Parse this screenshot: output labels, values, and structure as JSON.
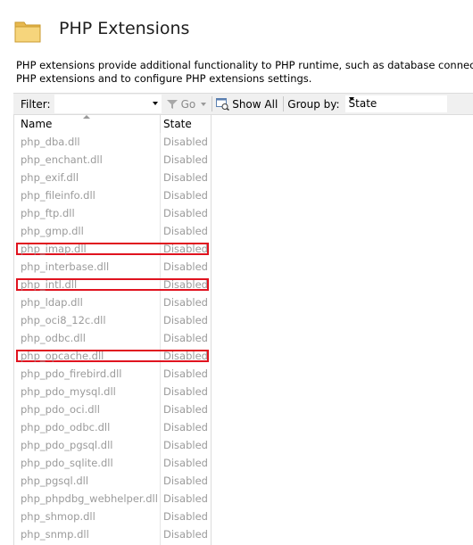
{
  "header": {
    "title": "PHP Extensions",
    "icon": "folder-icon"
  },
  "description": {
    "line1": "PHP extensions provide additional functionality to PHP runtime, such as database connectivity, c",
    "line2": "PHP extensions and to configure PHP extensions settings."
  },
  "toolbar": {
    "filter_label": "Filter:",
    "filter_value": "",
    "go_label": "Go",
    "show_all_label": "Show All",
    "group_by_label": "Group by:",
    "group_by_value": "State"
  },
  "grid": {
    "columns": [
      "Name",
      "State"
    ],
    "rows": [
      {
        "name": "php_dba.dll",
        "state": "Disabled",
        "highlighted": false
      },
      {
        "name": "php_enchant.dll",
        "state": "Disabled",
        "highlighted": false
      },
      {
        "name": "php_exif.dll",
        "state": "Disabled",
        "highlighted": false
      },
      {
        "name": "php_fileinfo.dll",
        "state": "Disabled",
        "highlighted": false
      },
      {
        "name": "php_ftp.dll",
        "state": "Disabled",
        "highlighted": false
      },
      {
        "name": "php_gmp.dll",
        "state": "Disabled",
        "highlighted": false
      },
      {
        "name": "php_imap.dll",
        "state": "Disabled",
        "highlighted": true
      },
      {
        "name": "php_interbase.dll",
        "state": "Disabled",
        "highlighted": false
      },
      {
        "name": "php_intl.dll",
        "state": "Disabled",
        "highlighted": true
      },
      {
        "name": "php_ldap.dll",
        "state": "Disabled",
        "highlighted": false
      },
      {
        "name": "php_oci8_12c.dll",
        "state": "Disabled",
        "highlighted": false
      },
      {
        "name": "php_odbc.dll",
        "state": "Disabled",
        "highlighted": false
      },
      {
        "name": "php_opcache.dll",
        "state": "Disabled",
        "highlighted": true
      },
      {
        "name": "php_pdo_firebird.dll",
        "state": "Disabled",
        "highlighted": false
      },
      {
        "name": "php_pdo_mysql.dll",
        "state": "Disabled",
        "highlighted": false
      },
      {
        "name": "php_pdo_oci.dll",
        "state": "Disabled",
        "highlighted": false
      },
      {
        "name": "php_pdo_odbc.dll",
        "state": "Disabled",
        "highlighted": false
      },
      {
        "name": "php_pdo_pgsql.dll",
        "state": "Disabled",
        "highlighted": false
      },
      {
        "name": "php_pdo_sqlite.dll",
        "state": "Disabled",
        "highlighted": false
      },
      {
        "name": "php_pgsql.dll",
        "state": "Disabled",
        "highlighted": false
      },
      {
        "name": "php_phpdbg_webhelper.dll",
        "state": "Disabled",
        "highlighted": false
      },
      {
        "name": "php_shmop.dll",
        "state": "Disabled",
        "highlighted": false
      },
      {
        "name": "php_snmp.dll",
        "state": "Disabled",
        "highlighted": false
      }
    ]
  },
  "colors": {
    "highlight_border": "#e0131f",
    "disabled_text": "#9b9b9b",
    "toolbar_bg": "#f0f0f0"
  }
}
